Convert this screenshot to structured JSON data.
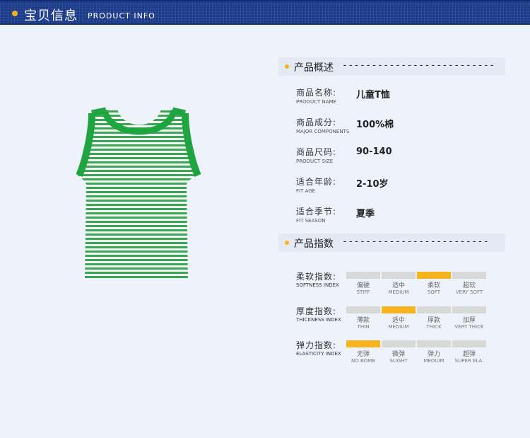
{
  "header": {
    "title": "宝贝信息",
    "subtitle": "PRODUCT INFO"
  },
  "overview": {
    "title": "产品概述",
    "dashes": "--------------------------",
    "specs": [
      {
        "label": "商品名称:",
        "label_en": "PRODUCT NAME",
        "value": "儿童T恤"
      },
      {
        "label": "商品成分:",
        "label_en": "MAJOR COMPONENTS",
        "value": "100%棉"
      },
      {
        "label": "商品尺码:",
        "label_en": "PRODUCT SIZE",
        "value": "90-140"
      },
      {
        "label": "适合年龄:",
        "label_en": "FIT AGE",
        "value": "2-10岁"
      },
      {
        "label": "适合季节:",
        "label_en": "FIT SEASON",
        "value": "夏季"
      }
    ]
  },
  "indices": {
    "title": "产品指数",
    "dashes": "-------------------------",
    "rows": [
      {
        "label": "柔软指数:",
        "label_en": "SOFTNESS INDEX",
        "selected": 2,
        "options": [
          {
            "cn": "偏硬",
            "en": "STIFF"
          },
          {
            "cn": "适中",
            "en": "MEDIUM"
          },
          {
            "cn": "柔软",
            "en": "SOFT"
          },
          {
            "cn": "超软",
            "en": "VERY SOFT"
          }
        ]
      },
      {
        "label": "厚度指数:",
        "label_en": "THICKNESS INDEX",
        "selected": 1,
        "options": [
          {
            "cn": "薄款",
            "en": "THIN"
          },
          {
            "cn": "适中",
            "en": "MEDIUM"
          },
          {
            "cn": "厚款",
            "en": "THICK"
          },
          {
            "cn": "加厚",
            "en": "VERY THICK"
          }
        ]
      },
      {
        "label": "弹力指数:",
        "label_en": "ELASTICITY INDEX",
        "selected": 0,
        "options": [
          {
            "cn": "无弹",
            "en": "NO BOMB"
          },
          {
            "cn": "微弹",
            "en": "SLIGHT"
          },
          {
            "cn": "弹力",
            "en": "MEDIUM"
          },
          {
            "cn": "超弹",
            "en": "SUPER ELA."
          }
        ]
      }
    ]
  },
  "colors": {
    "accent": "#f5b41c",
    "banner": "#1b3a8a",
    "stripe": "#2ea24a",
    "trim": "#1ea53f"
  }
}
